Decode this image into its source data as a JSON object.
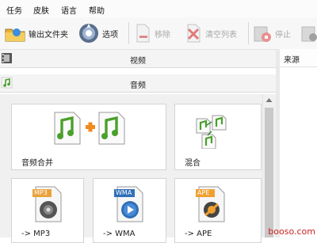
{
  "menu": {
    "items": [
      "任务",
      "皮肤",
      "语言",
      "帮助"
    ]
  },
  "toolbar": {
    "output_folder_label": "输出文件夹",
    "options_label": "选项",
    "remove_label": "移除",
    "clear_list_label": "清空列表",
    "stop_label": "停止"
  },
  "categories": {
    "video_label": "视频",
    "audio_label": "音频"
  },
  "tiles": {
    "merge_label": "音频合并",
    "mix_label": "混合",
    "mp3_label": "-> MP3",
    "wma_label": "-> WMA",
    "ape_label": "-> APE",
    "mp3_badge": "MP3",
    "wma_badge": "WMA",
    "ape_badge": "APE"
  },
  "right_panel": {
    "source_header": "来源"
  },
  "watermark": "booso.com",
  "colors": {
    "music_green": "#4aa02c",
    "plus_orange": "#f08a1c",
    "disabled_text": "#a8a8a8",
    "mp3_orange": "#e9a23b",
    "wma_blue": "#2f6fb7",
    "ape_orange": "#f0a030"
  }
}
